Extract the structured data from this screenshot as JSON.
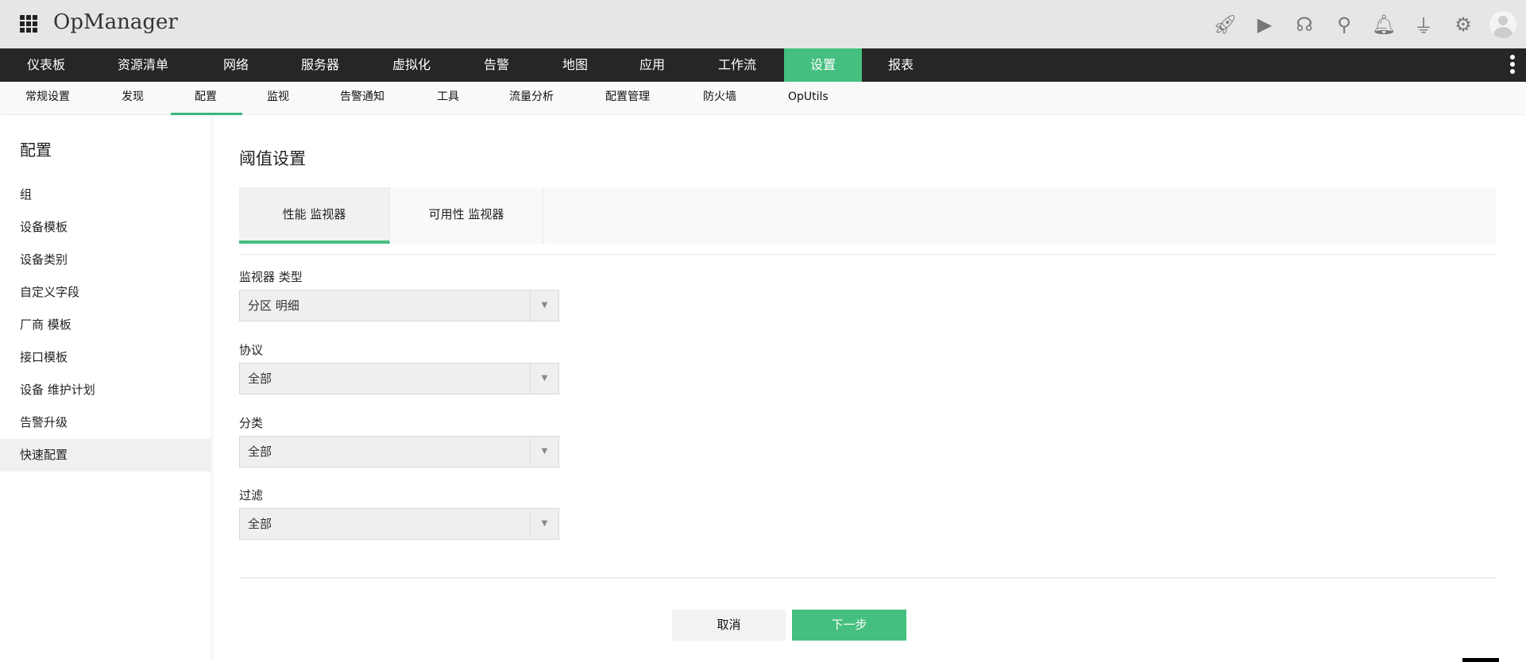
{
  "header": {
    "app_title": "OpManager",
    "icons": [
      "rocket-icon",
      "presentation-icon",
      "headset-icon",
      "search-icon",
      "bell-icon",
      "plug-icon",
      "gear-icon",
      "avatar"
    ]
  },
  "nav": {
    "items": [
      "仪表板",
      "资源清单",
      "网络",
      "服务器",
      "虚拟化",
      "告警",
      "地图",
      "应用",
      "工作流",
      "设置",
      "报表"
    ],
    "active": "设置"
  },
  "subnav": {
    "items": [
      "常规设置",
      "发现",
      "配置",
      "监视",
      "告警通知",
      "工具",
      "流量分析",
      "配置管理",
      "防火墙",
      "OpUtils"
    ],
    "active": "配置"
  },
  "sidebar": {
    "title": "配置",
    "items": [
      "组",
      "设备模板",
      "设备类别",
      "自定义字段",
      "厂商 模板",
      "接口模板",
      "设备 维护计划",
      "告警升级",
      "快速配置"
    ],
    "active": "快速配置"
  },
  "main": {
    "title": "阈值设置",
    "tabs": [
      "性能 监视器",
      "可用性 监视器"
    ],
    "active_tab": "性能 监视器",
    "fields": [
      {
        "label": "监视器 类型",
        "value": "分区 明细"
      },
      {
        "label": "协议",
        "value": "全部"
      },
      {
        "label": "分类",
        "value": "全部"
      },
      {
        "label": "过滤",
        "value": "全部"
      }
    ],
    "cancel": "取消",
    "next": "下一步"
  },
  "colors": {
    "accent": "#45bf7f",
    "nav_bg": "#262626"
  }
}
